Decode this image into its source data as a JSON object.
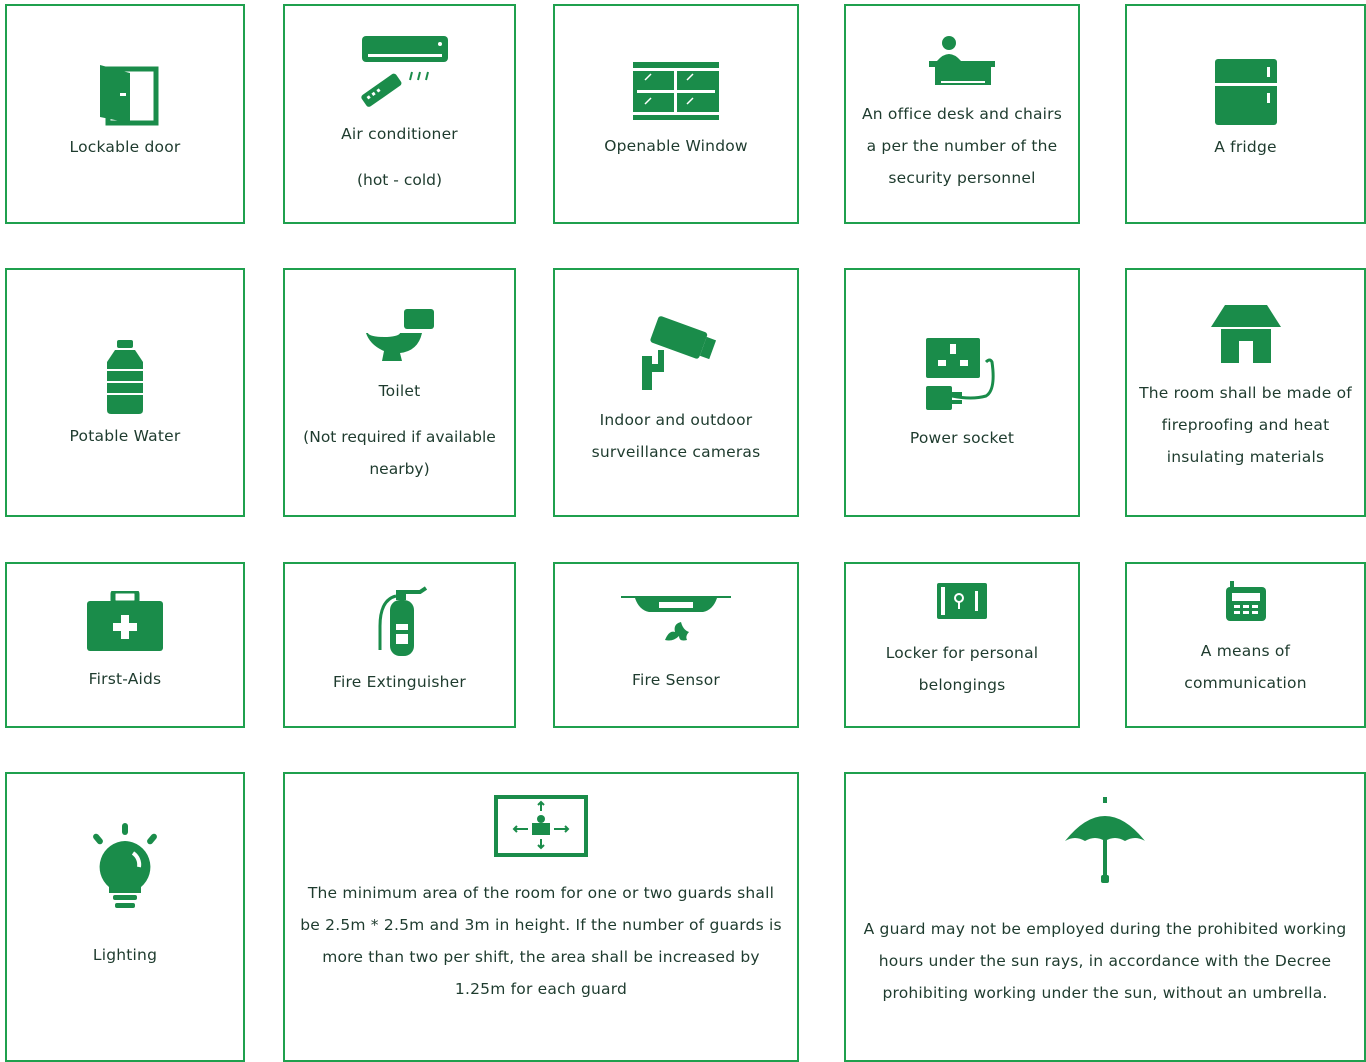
{
  "accent_color": "#1fa04e",
  "icon_color": "#1a8c4a",
  "cards": [
    {
      "icon": "door-icon",
      "label": "Lockable door"
    },
    {
      "icon": "air-conditioner-icon",
      "label": "Air conditioner",
      "sub": "(hot - cold)"
    },
    {
      "icon": "window-icon",
      "label": "Openable Window"
    },
    {
      "icon": "office-desk-icon",
      "label": "An office desk and chairs a per the number of the security personnel"
    },
    {
      "icon": "fridge-icon",
      "label": "A fridge"
    },
    {
      "icon": "water-bottle-icon",
      "label": "Potable Water"
    },
    {
      "icon": "toilet-icon",
      "label": "Toilet",
      "sub": "(Not required if available nearby)"
    },
    {
      "icon": "cctv-camera-icon",
      "label": "Indoor and outdoor surveillance cameras"
    },
    {
      "icon": "power-socket-icon",
      "label": "Power socket"
    },
    {
      "icon": "house-icon",
      "label": "The room shall be made of fireproofing and heat insulating materials"
    },
    {
      "icon": "first-aid-kit-icon",
      "label": "First-Aids"
    },
    {
      "icon": "fire-extinguisher-icon",
      "label": "Fire Extinguisher"
    },
    {
      "icon": "smoke-detector-icon",
      "label": "Fire Sensor"
    },
    {
      "icon": "safe-locker-icon",
      "label": "Locker for personal belongings"
    },
    {
      "icon": "walkie-talkie-icon",
      "label": "A means of communication"
    },
    {
      "icon": "light-bulb-icon",
      "label": "Lighting"
    },
    {
      "icon": "room-area-icon",
      "label": "The minimum area of the room for one or two guards shall be 2.5m * 2.5m and 3m in height. If the number of guards is more than two per shift, the area shall be increased by 1.25m for each guard"
    },
    {
      "icon": "umbrella-icon",
      "label": "A guard may not be employed during the prohibited working hours under the sun rays, in accordance with the Decree prohibiting working under the sun, without an umbrella."
    }
  ]
}
